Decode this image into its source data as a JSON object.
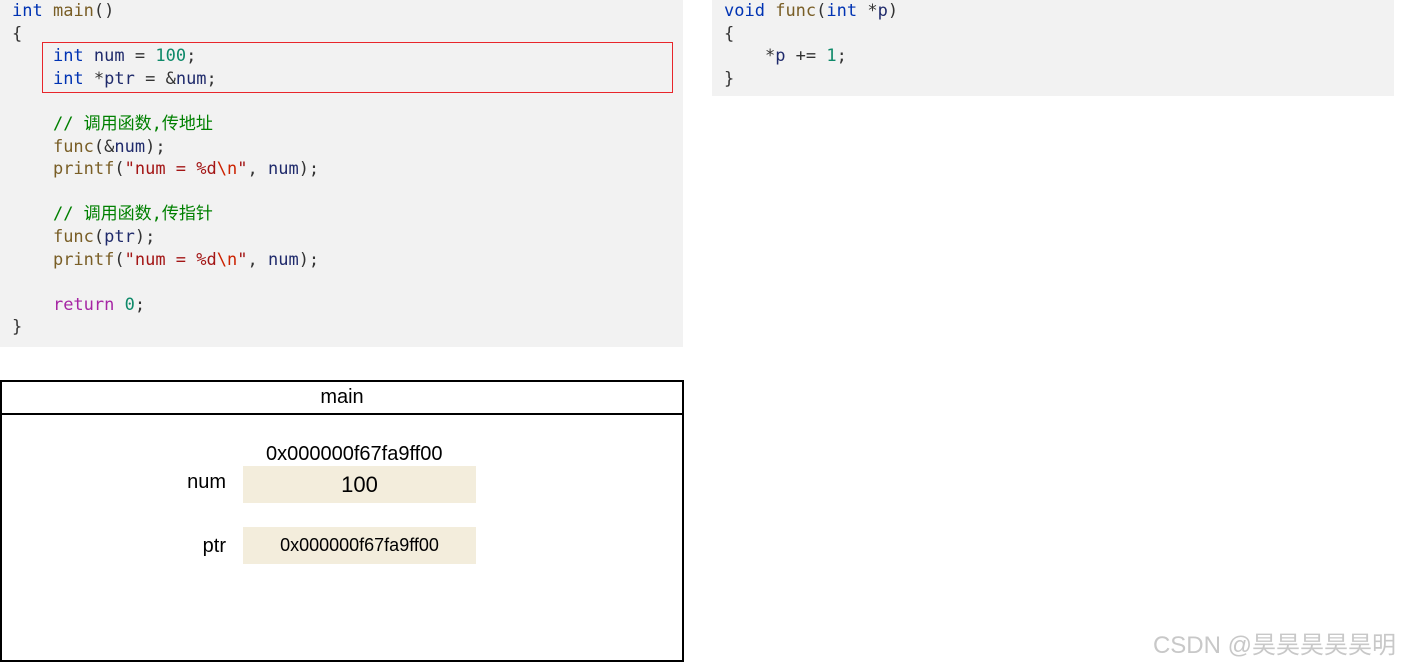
{
  "main_code": {
    "lines": [
      [
        {
          "t": "int",
          "c": "kw"
        },
        {
          "t": " ",
          "c": "punc"
        },
        {
          "t": "main",
          "c": "fn"
        },
        {
          "t": "()",
          "c": "punc"
        }
      ],
      [
        {
          "t": "{",
          "c": "punc"
        }
      ],
      [
        {
          "t": "    ",
          "c": "punc"
        },
        {
          "t": "int",
          "c": "kw"
        },
        {
          "t": " ",
          "c": "punc"
        },
        {
          "t": "num",
          "c": "var"
        },
        {
          "t": " = ",
          "c": "punc"
        },
        {
          "t": "100",
          "c": "num"
        },
        {
          "t": ";",
          "c": "punc"
        }
      ],
      [
        {
          "t": "    ",
          "c": "punc"
        },
        {
          "t": "int",
          "c": "kw"
        },
        {
          "t": " *",
          "c": "punc"
        },
        {
          "t": "ptr",
          "c": "var"
        },
        {
          "t": " = &",
          "c": "punc"
        },
        {
          "t": "num",
          "c": "var"
        },
        {
          "t": ";",
          "c": "punc"
        }
      ],
      [],
      [
        {
          "t": "    ",
          "c": "punc"
        },
        {
          "t": "// 调用函数,传地址",
          "c": "cmt"
        }
      ],
      [
        {
          "t": "    ",
          "c": "punc"
        },
        {
          "t": "func",
          "c": "fn"
        },
        {
          "t": "(&",
          "c": "punc"
        },
        {
          "t": "num",
          "c": "var"
        },
        {
          "t": ");",
          "c": "punc"
        }
      ],
      [
        {
          "t": "    ",
          "c": "punc"
        },
        {
          "t": "printf",
          "c": "fn"
        },
        {
          "t": "(",
          "c": "punc"
        },
        {
          "t": "\"num = %d",
          "c": "str"
        },
        {
          "t": "\\n",
          "c": "esc"
        },
        {
          "t": "\"",
          "c": "str"
        },
        {
          "t": ", ",
          "c": "punc"
        },
        {
          "t": "num",
          "c": "var"
        },
        {
          "t": ");",
          "c": "punc"
        }
      ],
      [],
      [
        {
          "t": "    ",
          "c": "punc"
        },
        {
          "t": "// 调用函数,传指针",
          "c": "cmt"
        }
      ],
      [
        {
          "t": "    ",
          "c": "punc"
        },
        {
          "t": "func",
          "c": "fn"
        },
        {
          "t": "(",
          "c": "punc"
        },
        {
          "t": "ptr",
          "c": "var"
        },
        {
          "t": ");",
          "c": "punc"
        }
      ],
      [
        {
          "t": "    ",
          "c": "punc"
        },
        {
          "t": "printf",
          "c": "fn"
        },
        {
          "t": "(",
          "c": "punc"
        },
        {
          "t": "\"num = %d",
          "c": "str"
        },
        {
          "t": "\\n",
          "c": "esc"
        },
        {
          "t": "\"",
          "c": "str"
        },
        {
          "t": ", ",
          "c": "punc"
        },
        {
          "t": "num",
          "c": "var"
        },
        {
          "t": ");",
          "c": "punc"
        }
      ],
      [],
      [
        {
          "t": "    ",
          "c": "punc"
        },
        {
          "t": "return",
          "c": "ret"
        },
        {
          "t": " ",
          "c": "punc"
        },
        {
          "t": "0",
          "c": "num"
        },
        {
          "t": ";",
          "c": "punc"
        }
      ],
      [
        {
          "t": "}",
          "c": "punc"
        }
      ]
    ]
  },
  "func_code": {
    "lines": [
      [
        {
          "t": "void",
          "c": "kw"
        },
        {
          "t": " ",
          "c": "punc"
        },
        {
          "t": "func",
          "c": "fn"
        },
        {
          "t": "(",
          "c": "punc"
        },
        {
          "t": "int",
          "c": "kw"
        },
        {
          "t": " *",
          "c": "punc"
        },
        {
          "t": "p",
          "c": "var"
        },
        {
          "t": ")",
          "c": "punc"
        }
      ],
      [
        {
          "t": "{",
          "c": "punc"
        }
      ],
      [
        {
          "t": "    *",
          "c": "punc"
        },
        {
          "t": "p",
          "c": "var"
        },
        {
          "t": " += ",
          "c": "punc"
        },
        {
          "t": "1",
          "c": "num"
        },
        {
          "t": ";",
          "c": "punc"
        }
      ],
      [
        {
          "t": "}",
          "c": "punc"
        }
      ]
    ]
  },
  "highlight_color": "#e8262b",
  "memory_frame": {
    "title": "main",
    "num_address": "0x000000f67fa9ff00",
    "num_label": "num",
    "num_value": "100",
    "ptr_label": "ptr",
    "ptr_value": "0x000000f67fa9ff00",
    "cell_color": "#f3eddc"
  },
  "watermark": "CSDN @昊昊昊昊昊明"
}
